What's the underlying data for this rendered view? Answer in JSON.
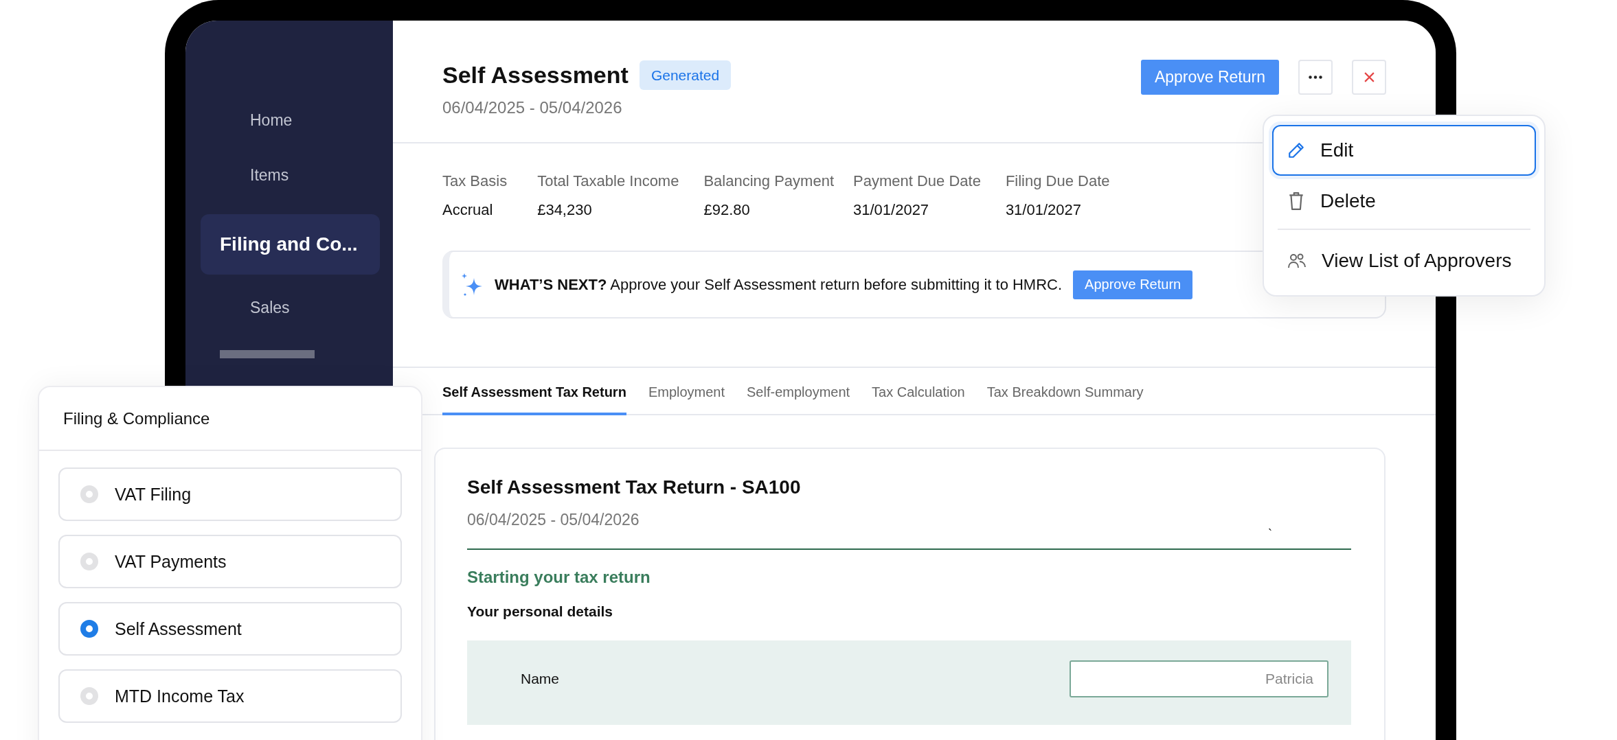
{
  "sidebar": {
    "items": [
      {
        "label": "Home",
        "selected": false
      },
      {
        "label": "Items",
        "selected": false
      },
      {
        "label": "Filing and Co...",
        "selected": true
      },
      {
        "label": "Sales",
        "selected": false
      }
    ]
  },
  "header": {
    "title": "Self Assessment",
    "status": "Generated",
    "period": "06/04/2025 - 05/04/2026",
    "primary_action": "Approve Return"
  },
  "summary": [
    {
      "label": "Tax Basis",
      "value": "Accrual"
    },
    {
      "label": "Total Taxable Income",
      "value": "£34,230"
    },
    {
      "label": "Balancing Payment",
      "value": "£92.80"
    },
    {
      "label": "Payment Due Date",
      "value": "31/01/2027"
    },
    {
      "label": "Filing Due Date",
      "value": "31/01/2027"
    }
  ],
  "notice": {
    "text": "**WHAT’S NEXT?** Approve your Self Assessment return before submitting it to HMRC.",
    "button": "Approve Return"
  },
  "tabs": [
    {
      "label": "Self Assessment Tax Return",
      "selected": true
    },
    {
      "label": "Employment",
      "selected": false
    },
    {
      "label": "Self-employment",
      "selected": false
    },
    {
      "label": "Tax Calculation",
      "selected": false
    },
    {
      "label": "Tax Breakdown Summary",
      "selected": false
    }
  ],
  "form": {
    "title": "Self Assessment Tax Return - SA100",
    "period": "06/04/2025 - 05/04/2026",
    "stray_mark": "`",
    "section": "Starting your tax return",
    "subsection": "Your personal details",
    "fields": [
      {
        "label": "Name",
        "value": "Patricia"
      }
    ]
  },
  "filing_panel": {
    "title": "Filing & Compliance",
    "options": [
      {
        "label": "VAT Filing",
        "selected": false
      },
      {
        "label": "VAT Payments",
        "selected": false
      },
      {
        "label": "Self Assessment",
        "selected": true
      },
      {
        "label": "MTD Income Tax",
        "selected": false
      }
    ]
  },
  "menu": {
    "items": [
      {
        "label": "Edit",
        "kind": "edit",
        "selected": true
      },
      {
        "label": "Delete",
        "kind": "delete",
        "selected": false
      },
      {
        "label": "View List of Approvers",
        "kind": "approvers",
        "selected": false
      }
    ]
  }
}
